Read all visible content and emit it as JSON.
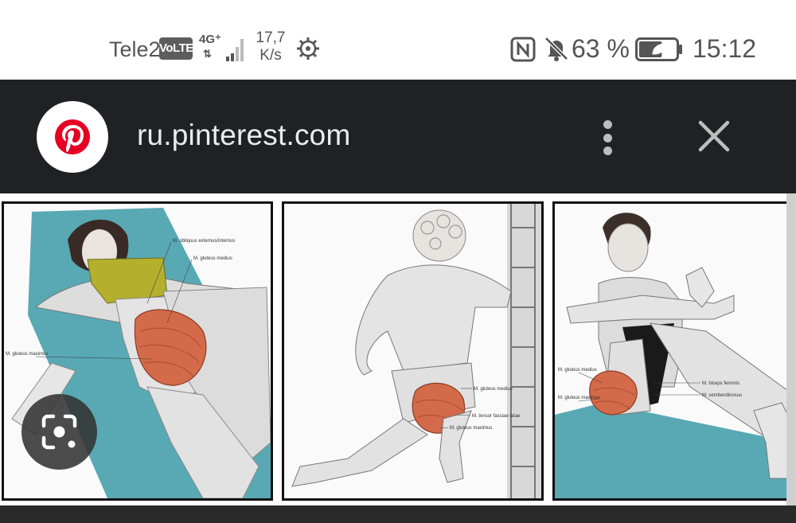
{
  "status_bar": {
    "carrier": "Tele2",
    "volte": "VoLTE",
    "network_type": "4G⁺",
    "network_arrows": "⇅",
    "speed_value": "17,7",
    "speed_unit": "K/s",
    "icons": [
      "signal-icon",
      "gear-icon",
      "nfc-icon",
      "mute-bell-icon",
      "battery-icon"
    ],
    "battery_percent": "63 %",
    "battery_level": 0.63,
    "time": "15:12"
  },
  "browser": {
    "site_icon": "pinterest-logo",
    "url": "ru.pinterest.com",
    "menu_icon": "more-vertical-icon",
    "close_icon": "close-icon"
  },
  "content": {
    "lens_icon": "lens-search-icon",
    "images": [
      {
        "labels": [
          "M. obliquus externus/internus",
          "M. gluteus medius",
          "M. gluteus maximus"
        ]
      },
      {
        "labels": [
          "M. gluteus medius",
          "M. tensor fasciae latae",
          "M. gluteus maximus"
        ]
      },
      {
        "labels": [
          "M. gluteus medius",
          "M. gluteus maximus",
          "M. biceps femoris",
          "M. semitendinosus"
        ]
      }
    ]
  },
  "colors": {
    "browser_bar": "#202124",
    "pinterest_red": "#e60023",
    "yoga_mat": "#58a9b4",
    "muscle_highlight": "#d36a49"
  }
}
